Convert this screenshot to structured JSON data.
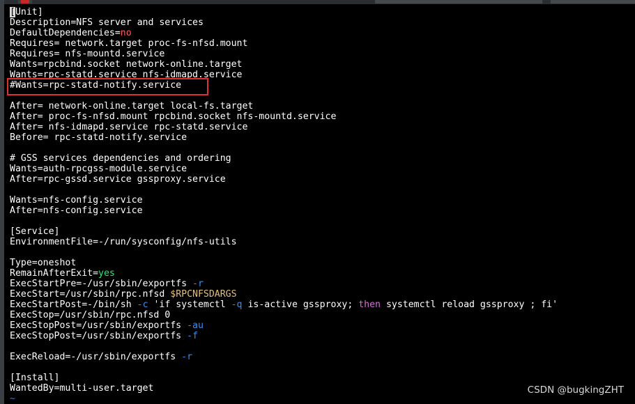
{
  "editor": {
    "lines": [
      {
        "parts": [
          {
            "t": "[",
            "c": "cursor"
          },
          {
            "t": "Unit]"
          }
        ]
      },
      {
        "parts": [
          {
            "t": "Description=NFS server and services"
          }
        ]
      },
      {
        "parts": [
          {
            "t": "DefaultDependencies="
          },
          {
            "t": "no",
            "c": "k-red"
          }
        ]
      },
      {
        "parts": [
          {
            "t": "Requires= network.target proc-fs-nfsd.mount"
          }
        ]
      },
      {
        "parts": [
          {
            "t": "Requires= nfs-mountd.service"
          }
        ]
      },
      {
        "parts": [
          {
            "t": "Wants=rpcbind.socket network-online.target"
          }
        ]
      },
      {
        "parts": [
          {
            "t": "Wants=rpc-statd.service nfs-idmapd.service"
          }
        ]
      },
      {
        "parts": [
          {
            "t": "#Wants=rpc-statd-notify.service"
          }
        ]
      },
      {
        "parts": []
      },
      {
        "parts": [
          {
            "t": "After= network-online.target local-fs.target"
          }
        ]
      },
      {
        "parts": [
          {
            "t": "After= proc-fs-nfsd.mount rpcbind.socket nfs-mountd.service"
          }
        ]
      },
      {
        "parts": [
          {
            "t": "After= nfs-idmapd.service rpc-statd.service"
          }
        ]
      },
      {
        "parts": [
          {
            "t": "Before= rpc-statd-notify.service"
          }
        ]
      },
      {
        "parts": []
      },
      {
        "parts": [
          {
            "t": "# GSS services dependencies and ordering"
          }
        ]
      },
      {
        "parts": [
          {
            "t": "Wants=auth-rpcgss-module.service"
          }
        ]
      },
      {
        "parts": [
          {
            "t": "After=rpc-gssd.service gssproxy.service"
          }
        ]
      },
      {
        "parts": []
      },
      {
        "parts": [
          {
            "t": "Wants=nfs-config.service"
          }
        ]
      },
      {
        "parts": [
          {
            "t": "After=nfs-config.service"
          }
        ]
      },
      {
        "parts": []
      },
      {
        "parts": [
          {
            "t": "[Service]"
          }
        ]
      },
      {
        "parts": [
          {
            "t": "EnvironmentFile=-/run/sysconfig/nfs-utils"
          }
        ]
      },
      {
        "parts": []
      },
      {
        "parts": [
          {
            "t": "Type=oneshot"
          }
        ]
      },
      {
        "parts": [
          {
            "t": "RemainAfterExit="
          },
          {
            "t": "yes",
            "c": "k-green"
          }
        ]
      },
      {
        "parts": [
          {
            "t": "ExecStartPre=-/usr/sbin/exportfs "
          },
          {
            "t": "-r",
            "c": "k-blue"
          }
        ]
      },
      {
        "parts": [
          {
            "t": "ExecStart=/usr/sbin/rpc.nfsd "
          },
          {
            "t": "$RPCNFSDARGS",
            "c": "k-yellow"
          }
        ]
      },
      {
        "parts": [
          {
            "t": "ExecStartPost=-/bin/sh "
          },
          {
            "t": "-c",
            "c": "k-blue"
          },
          {
            "t": " 'if systemctl "
          },
          {
            "t": "-q",
            "c": "k-blue"
          },
          {
            "t": " is-active gssproxy; "
          },
          {
            "t": "then",
            "c": "k-magenta"
          },
          {
            "t": " systemctl reload gssproxy ; fi'"
          }
        ]
      },
      {
        "parts": [
          {
            "t": "ExecStop=/usr/sbin/rpc.nfsd 0"
          }
        ]
      },
      {
        "parts": [
          {
            "t": "ExecStopPost=/usr/sbin/exportfs "
          },
          {
            "t": "-au",
            "c": "k-blue"
          }
        ]
      },
      {
        "parts": [
          {
            "t": "ExecStopPost=/usr/sbin/exportfs "
          },
          {
            "t": "-f",
            "c": "k-blue"
          }
        ]
      },
      {
        "parts": []
      },
      {
        "parts": [
          {
            "t": "ExecReload=-/usr/sbin/exportfs "
          },
          {
            "t": "-r",
            "c": "k-blue"
          }
        ]
      },
      {
        "parts": []
      },
      {
        "parts": [
          {
            "t": "[Install]"
          }
        ]
      },
      {
        "parts": [
          {
            "t": "WantedBy=multi-user.target"
          }
        ]
      },
      {
        "parts": [
          {
            "t": "~",
            "c": "tilde"
          }
        ]
      }
    ]
  },
  "watermark": "CSDN @bugkingZHT",
  "colors": {
    "background": "#000000",
    "text": "#ffffff",
    "keyword_red": "#ff5c57",
    "keyword_green": "#2ee67a",
    "flag_blue": "#3b8eea",
    "variable_yellow": "#e5c07b",
    "keyword_magenta": "#d670d6",
    "highlight_box": "#e03030"
  }
}
